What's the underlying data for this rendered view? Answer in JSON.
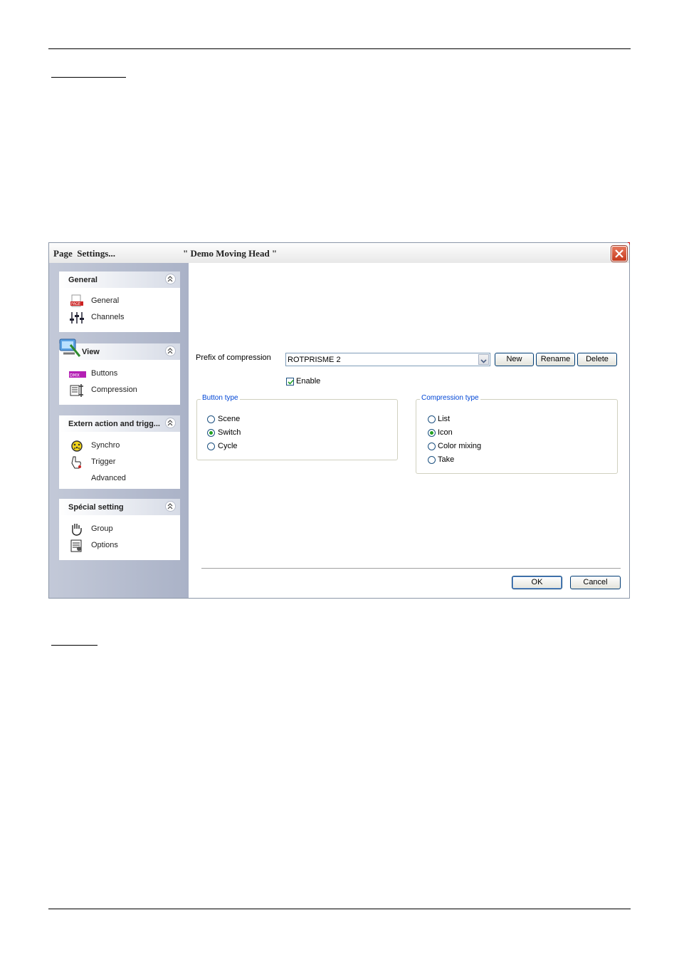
{
  "window": {
    "title_left": "Page  Settings...",
    "title_right": "\" Demo Moving Head \""
  },
  "sidebar": {
    "groups": [
      {
        "title": "General",
        "items": [
          {
            "label": "General",
            "icon": "page-icon"
          },
          {
            "label": "Channels",
            "icon": "faders-icon"
          }
        ]
      },
      {
        "title": "View",
        "items": [
          {
            "label": "Buttons",
            "icon": "buttons-icon"
          },
          {
            "label": "Compression",
            "icon": "compression-icon"
          }
        ]
      },
      {
        "title": "Extern action and trigg...",
        "items": [
          {
            "label": "Synchro",
            "icon": "synchro-icon"
          },
          {
            "label": "Trigger",
            "icon": "trigger-hand-icon"
          },
          {
            "label": "Advanced",
            "icon": ""
          }
        ]
      },
      {
        "title": "Spécial setting",
        "items": [
          {
            "label": "Group",
            "icon": "hand-icon"
          },
          {
            "label": "Options",
            "icon": "options-icon"
          }
        ]
      }
    ]
  },
  "content": {
    "prefix_label": "Prefix of compression",
    "prefix_value": "ROTPRISME 2",
    "buttons": {
      "new": "New",
      "rename": "Rename",
      "delete": "Delete",
      "ok": "OK",
      "cancel": "Cancel"
    },
    "enable_label": "Enable",
    "enable_checked": true,
    "button_type": {
      "legend": "Button type",
      "options": [
        "Scene",
        "Switch",
        "Cycle"
      ],
      "selected": "Switch"
    },
    "compression_type": {
      "legend": "Compression type",
      "options": [
        "List",
        "Icon",
        "Color mixing",
        "Take"
      ],
      "selected": "Icon"
    }
  },
  "colors": {
    "accent": "#0046d5",
    "radio_selected": "#21a121",
    "close_button": "#c6391c"
  }
}
